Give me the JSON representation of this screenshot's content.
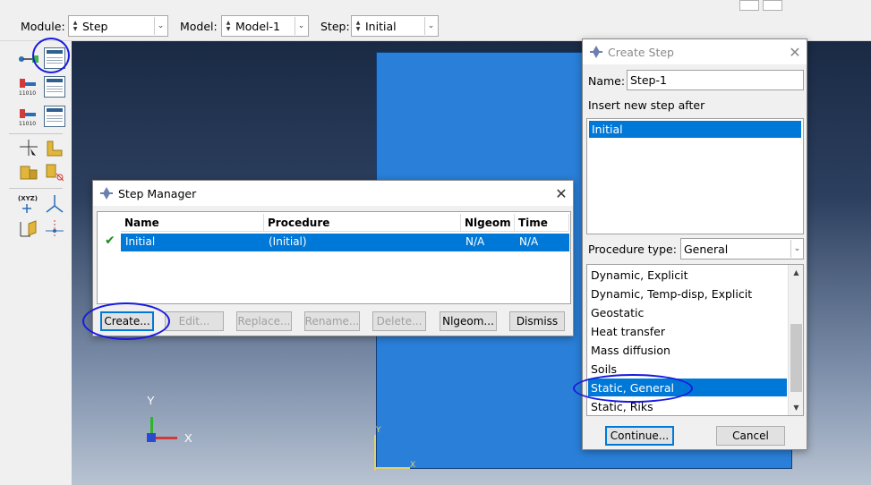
{
  "context_bar": {
    "module_label": "Module:",
    "module_value": "Step",
    "model_label": "Model:",
    "model_value": "Model-1",
    "step_label": "Step:",
    "step_value": "Initial"
  },
  "toolbox": {
    "xyz_label": "(XYZ)"
  },
  "viewport": {
    "triad": {
      "y": "Y",
      "x": "X"
    },
    "part_triad": {
      "y": "Y",
      "x": "X"
    }
  },
  "step_manager": {
    "title": "Step Manager",
    "columns": [
      "Name",
      "Procedure",
      "Nlgeom",
      "Time"
    ],
    "rows": [
      {
        "name": "Initial",
        "procedure": "(Initial)",
        "nlgeom": "N/A",
        "time": "N/A"
      }
    ],
    "buttons": {
      "create": "Create...",
      "edit": "Edit...",
      "replace": "Replace...",
      "rename": "Rename...",
      "delete": "Delete...",
      "nlgeom": "Nlgeom...",
      "dismiss": "Dismiss"
    }
  },
  "create_step": {
    "title": "Create Step",
    "name_label": "Name:",
    "name_value": "Step-1",
    "insert_label": "Insert new step after",
    "insert_items": [
      "Initial"
    ],
    "procedure_type_label": "Procedure type:",
    "procedure_type_value": "General",
    "procedures": [
      "Dynamic, Explicit",
      "Dynamic, Temp-disp, Explicit",
      "Geostatic",
      "Heat transfer",
      "Mass diffusion",
      "Soils",
      "Static, General",
      "Static, Riks"
    ],
    "selected_procedure": "Static, General",
    "continue_label": "Continue...",
    "cancel_label": "Cancel"
  },
  "colors": {
    "selection": "#0078d7",
    "part": "#2a7fd8",
    "annotation": "#1a1ae0"
  }
}
